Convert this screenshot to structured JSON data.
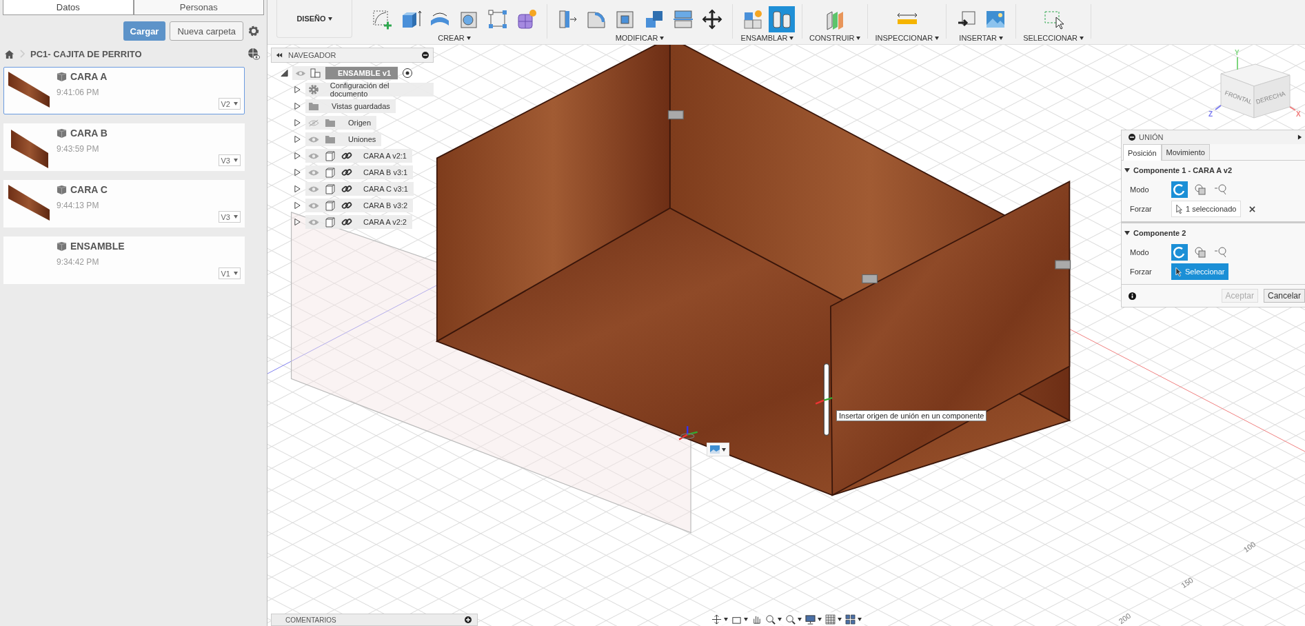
{
  "left_panel": {
    "tabs": [
      {
        "label": "Datos",
        "selected": true
      },
      {
        "label": "Personas",
        "selected": false
      }
    ],
    "upload_button": "Cargar",
    "new_folder_button": "Nueva carpeta",
    "breadcrumb": "PC1- CAJITA DE PERRITO",
    "files": [
      {
        "name": "CARA A",
        "time": "9:41:06 PM",
        "version": "V2",
        "selected": true,
        "thumbnail": true
      },
      {
        "name": "CARA B",
        "time": "9:43:59 PM",
        "version": "V3",
        "selected": false,
        "thumbnail": true
      },
      {
        "name": "CARA C",
        "time": "9:44:13 PM",
        "version": "V3",
        "selected": false,
        "thumbnail": true
      },
      {
        "name": "ENSAMBLE",
        "time": "9:34:42 PM",
        "version": "V1",
        "selected": false,
        "thumbnail": false
      }
    ]
  },
  "toolbar": {
    "workspace": "DISEÑO",
    "groups": [
      {
        "label": "CREAR",
        "tools": [
          {
            "kind": "sketch",
            "selected": false
          },
          {
            "kind": "extrude",
            "selected": false
          },
          {
            "kind": "revolve",
            "selected": false
          },
          {
            "kind": "hole",
            "selected": false
          },
          {
            "kind": "pattern",
            "selected": false
          },
          {
            "kind": "form",
            "selected": false
          }
        ]
      },
      {
        "label": "MODIFICAR",
        "tools": [
          {
            "kind": "press-pull",
            "selected": false
          },
          {
            "kind": "fillet",
            "selected": false
          },
          {
            "kind": "shell",
            "selected": false
          },
          {
            "kind": "combine",
            "selected": false
          },
          {
            "kind": "split",
            "selected": false
          },
          {
            "kind": "move",
            "selected": false
          }
        ]
      },
      {
        "label": "ENSAMBLAR",
        "tools": [
          {
            "kind": "component",
            "selected": false
          },
          {
            "kind": "joint",
            "selected": true
          }
        ]
      },
      {
        "label": "CONSTRUIR",
        "tools": [
          {
            "kind": "plane",
            "selected": false
          }
        ]
      },
      {
        "label": "INSPECCIONAR",
        "tools": [
          {
            "kind": "measure",
            "selected": false
          }
        ]
      },
      {
        "label": "INSERTAR",
        "tools": [
          {
            "kind": "insert",
            "selected": false
          },
          {
            "kind": "image",
            "selected": false
          }
        ]
      },
      {
        "label": "SELECCIONAR",
        "tools": [
          {
            "kind": "select",
            "selected": false
          }
        ]
      }
    ]
  },
  "navigator": {
    "title": "NAVEGADOR",
    "root": {
      "label": "ENSAMBLE v1",
      "expanded": true,
      "visible": true,
      "children": [
        {
          "label": "Configuración del documento",
          "kind": "settings",
          "expanded": false
        },
        {
          "label": "Vistas guardadas",
          "kind": "folder",
          "expanded": false
        },
        {
          "label": "Origen",
          "kind": "folder",
          "visible": false,
          "expanded": false
        },
        {
          "label": "Uniones",
          "kind": "folder",
          "visible": true,
          "expanded": false
        },
        {
          "label": "CARA A v2:1",
          "kind": "component",
          "visible": true,
          "expanded": false
        },
        {
          "label": "CARA B v3:1",
          "kind": "component",
          "visible": true,
          "expanded": false
        },
        {
          "label": "CARA C v3:1",
          "kind": "component",
          "visible": true,
          "expanded": false
        },
        {
          "label": "CARA B v3:2",
          "kind": "component",
          "visible": true,
          "expanded": false
        },
        {
          "label": "CARA A v2:2",
          "kind": "component",
          "visible": true,
          "expanded": false
        }
      ]
    }
  },
  "viewcube": {
    "faces": [
      "FRONTAL",
      "DERECHA"
    ],
    "axes": [
      {
        "label": "Y",
        "color": "#7ed67e"
      },
      {
        "label": "Z",
        "color": "#7a7af0"
      },
      {
        "label": "X",
        "color": "#f07a7a"
      }
    ]
  },
  "ruler_labels": [
    "100",
    "150",
    "200"
  ],
  "tooltip": "Insertar origen de unión en un componente",
  "union_panel": {
    "title": "UNIÓN",
    "tabs": [
      {
        "label": "Posición",
        "selected": true
      },
      {
        "label": "Movimiento",
        "selected": false
      }
    ],
    "sections": [
      {
        "title": "Componente 1 - CARA A v2",
        "expanded": true,
        "mode_label": "Modo",
        "modes": [
          {
            "kind": "simple",
            "selected": true
          },
          {
            "kind": "between",
            "selected": false
          },
          {
            "kind": "center",
            "selected": false
          }
        ],
        "snap_label": "Forzar",
        "snap": {
          "kind": "picked",
          "text": "1 seleccionado"
        }
      },
      {
        "title": "Componente 2",
        "expanded": true,
        "mode_label": "Modo",
        "modes": [
          {
            "kind": "simple",
            "selected": true
          },
          {
            "kind": "between",
            "selected": false
          },
          {
            "kind": "center",
            "selected": false
          }
        ],
        "snap_label": "Forzar",
        "snap": {
          "kind": "picking",
          "text": "Seleccionar"
        }
      }
    ],
    "buttons": [
      {
        "label": "Aceptar",
        "disabled": true
      },
      {
        "label": "Cancelar",
        "disabled": false
      }
    ]
  },
  "comments_bar": {
    "title": "COMENTARIOS"
  }
}
